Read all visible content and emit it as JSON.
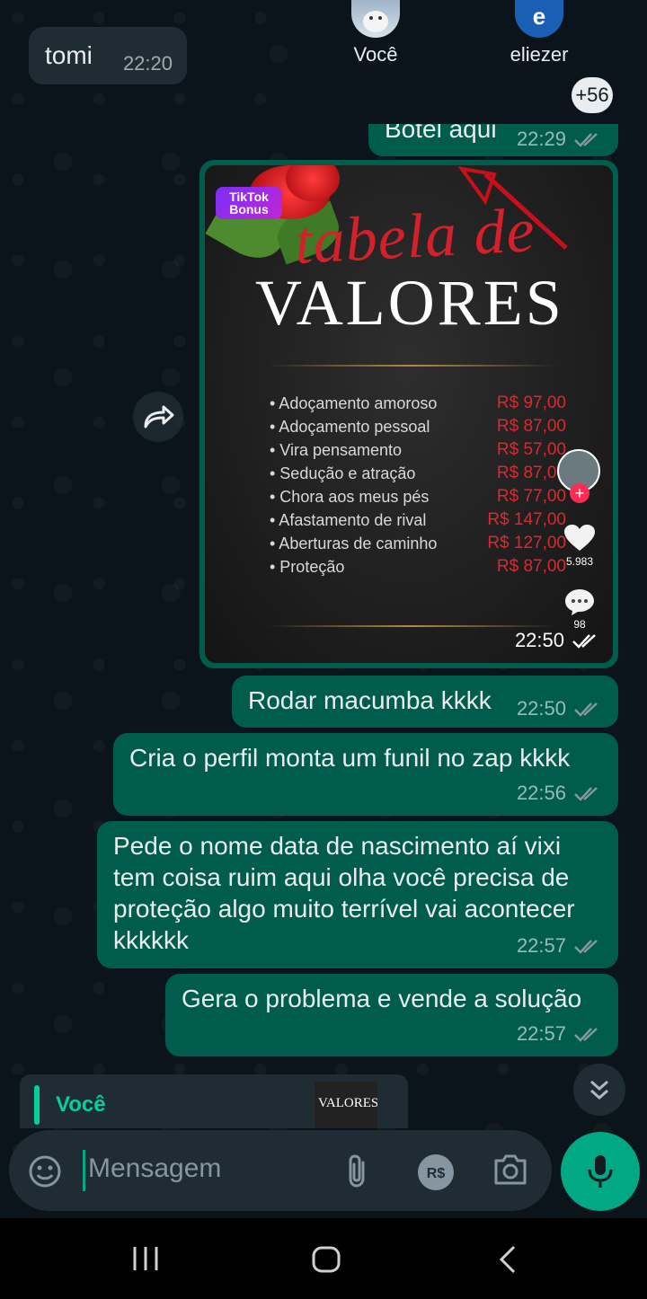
{
  "reactions": {
    "users": [
      {
        "name": "Você"
      },
      {
        "name": "eliezer",
        "initial": "e"
      }
    ],
    "more_count": "+56"
  },
  "messages": [
    {
      "type": "incoming",
      "text": "tomi",
      "time": "22:20"
    },
    {
      "type": "outgoing",
      "text": "Botel aqui",
      "time": "22:29"
    },
    {
      "type": "outgoing",
      "text": "Rodar macumba kkkk",
      "time": "22:50"
    },
    {
      "type": "outgoing",
      "text": "Cria o perfil monta um funil no zap kkkk",
      "time": "22:56"
    },
    {
      "type": "outgoing",
      "text": "Pede o nome data de nascimento aí vixi tem coisa ruim aqui olha você precisa de proteção algo muito terrível vai acontecer kkkkkk",
      "time": "22:57"
    },
    {
      "type": "outgoing",
      "text": "Gera o problema e vende a solução",
      "time": "22:57"
    }
  ],
  "image_message": {
    "time": "22:50",
    "badge": "TikTok Bonus",
    "title_line1": "tabela de",
    "title_line2": "VALORES",
    "likes": "5.983",
    "comments": "98",
    "items": [
      {
        "name": "• Adoçamento amoroso",
        "price": "R$ 97,00"
      },
      {
        "name": "• Adoçamento pessoal",
        "price": "R$ 87,00"
      },
      {
        "name": "• Vira pensamento",
        "price": "R$ 57,00"
      },
      {
        "name": "• Sedução e atração",
        "price": "R$ 87,00"
      },
      {
        "name": "• Chora aos meus pés",
        "price": "R$ 77,00"
      },
      {
        "name": "• Afastamento de rival",
        "price": "R$ 147,00"
      },
      {
        "name": "• Aberturas de caminho",
        "price": "R$ 127,00"
      },
      {
        "name": "• Proteção",
        "price": "R$ 87,00"
      }
    ]
  },
  "reply": {
    "author": "Você",
    "thumb_text": "VALORES"
  },
  "composer": {
    "placeholder": "Mensagem"
  },
  "colors": {
    "background": "#0b141a",
    "incoming_bubble": "#1f2c34",
    "outgoing_bubble": "#005c4b",
    "accent": "#00a884",
    "price_red": "#e0262e"
  },
  "icons": [
    "forward-icon",
    "chevrons-down-icon",
    "emoji-icon",
    "attach-icon",
    "payment-icon",
    "camera-icon",
    "mic-icon",
    "nav-recents-icon",
    "nav-home-icon",
    "nav-back-icon"
  ]
}
